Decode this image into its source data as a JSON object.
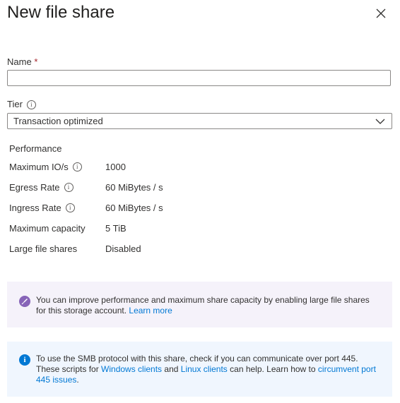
{
  "panel": {
    "title": "New file share",
    "close_icon": "close-icon"
  },
  "form": {
    "name": {
      "label": "Name",
      "required_marker": "*",
      "value": "",
      "placeholder": ""
    },
    "tier": {
      "label": "Tier",
      "selected": "Transaction optimized"
    }
  },
  "performance": {
    "heading": "Performance",
    "rows": [
      {
        "label": "Maximum IO/s",
        "value": "1000"
      },
      {
        "label": "Egress Rate",
        "value": "60 MiBytes / s"
      },
      {
        "label": "Ingress Rate",
        "value": "60 MiBytes / s"
      },
      {
        "label": "Maximum capacity",
        "value": "5 TiB"
      },
      {
        "label": "Large file shares",
        "value": "Disabled"
      }
    ]
  },
  "banners": {
    "large_file": {
      "text": "You can improve performance and maximum share capacity by enabling large file shares for this storage account. ",
      "link": "Learn more",
      "icon": "rocket-icon",
      "color": "#8764b8"
    },
    "smb": {
      "text1": "To use the SMB protocol with this share, check if you can communicate over port 445. These scripts for ",
      "link1": "Windows clients",
      "text2": " and ",
      "link2": "Linux clients",
      "text3": " can help. Learn how to ",
      "link3": "circumvent port 445 issues",
      "text4": ".",
      "icon": "info-icon",
      "icon_glyph": "i",
      "color": "#0078d4"
    }
  }
}
